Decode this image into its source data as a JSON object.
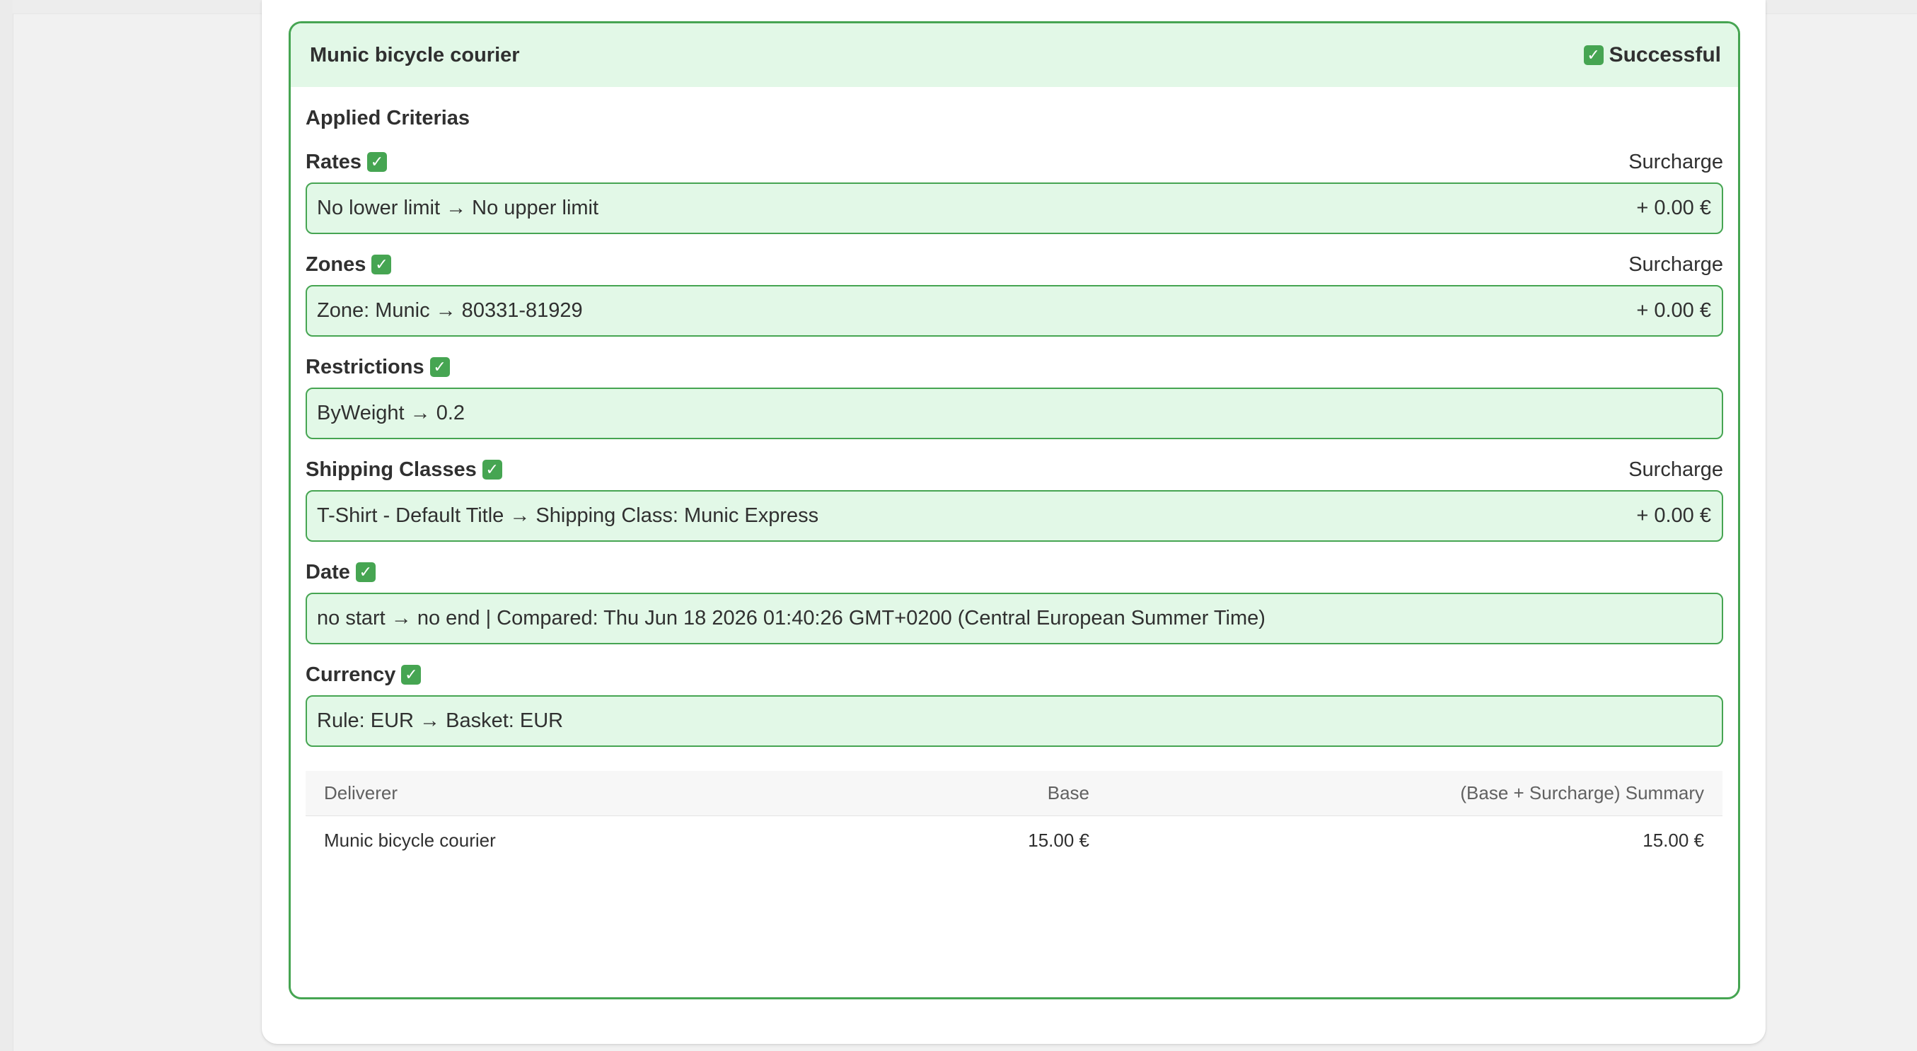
{
  "rule": {
    "title": "Munic bicycle courier",
    "status": "Successful",
    "applied_title": "Applied Criterias"
  },
  "criteria": [
    {
      "label": "Rates",
      "surcharge_label": "Surcharge",
      "value": "No lower limit → No upper limit",
      "surcharge": "+ 0.00 €"
    },
    {
      "label": "Zones",
      "surcharge_label": "Surcharge",
      "value": "Zone: Munic → 80331-81929",
      "surcharge": "+ 0.00 €"
    },
    {
      "label": "Restrictions",
      "surcharge_label": "",
      "value": "ByWeight → 0.2",
      "surcharge": ""
    },
    {
      "label": "Shipping Classes",
      "surcharge_label": "Surcharge",
      "value": "T-Shirt - Default Title → Shipping Class: Munic Express",
      "surcharge": "+ 0.00 €"
    },
    {
      "label": "Date",
      "surcharge_label": "",
      "value": "no start → no end | Compared: Thu Jun 18 2026 01:40:26 GMT+0200 (Central European Summer Time)",
      "surcharge": ""
    },
    {
      "label": "Currency",
      "surcharge_label": "",
      "value": "Rule: EUR → Basket: EUR",
      "surcharge": ""
    }
  ],
  "summary": {
    "headers": {
      "deliverer": "Deliverer",
      "base": "Base",
      "total": "(Base + Surcharge) Summary"
    },
    "row": {
      "deliverer": "Munic bicycle courier",
      "base": "15.00 €",
      "total": "15.00 €"
    }
  },
  "icons": {
    "check_glyph": "✓",
    "check_name": "check-mark-icon"
  },
  "colors": {
    "success_border": "#46a552",
    "success_fill": "#e2f8e7",
    "text": "#303030"
  }
}
